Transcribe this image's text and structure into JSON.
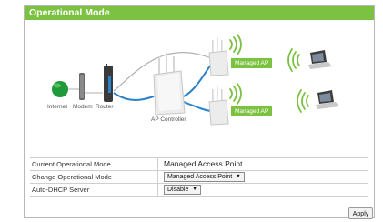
{
  "header": {
    "title": "Operational Mode"
  },
  "diagram": {
    "labels": {
      "internet": "Internet",
      "modem": "Modem",
      "router": "Router",
      "ap_controller": "AP Controller",
      "managed_ap_top": "Managed AP",
      "managed_ap_bottom": "Managed AP"
    },
    "colors": {
      "accent": "#7cc242",
      "globe": "#1e9a3a",
      "cable": "#2a82c9"
    }
  },
  "settings": {
    "rows": [
      {
        "label": "Current Operational Mode",
        "value": "Managed Access Point"
      },
      {
        "label": "Change Operational Mode",
        "value": "Managed Access Point"
      },
      {
        "label": "Auto-DHCP Server",
        "value": "Disable"
      }
    ]
  },
  "buttons": {
    "apply": "Apply"
  }
}
